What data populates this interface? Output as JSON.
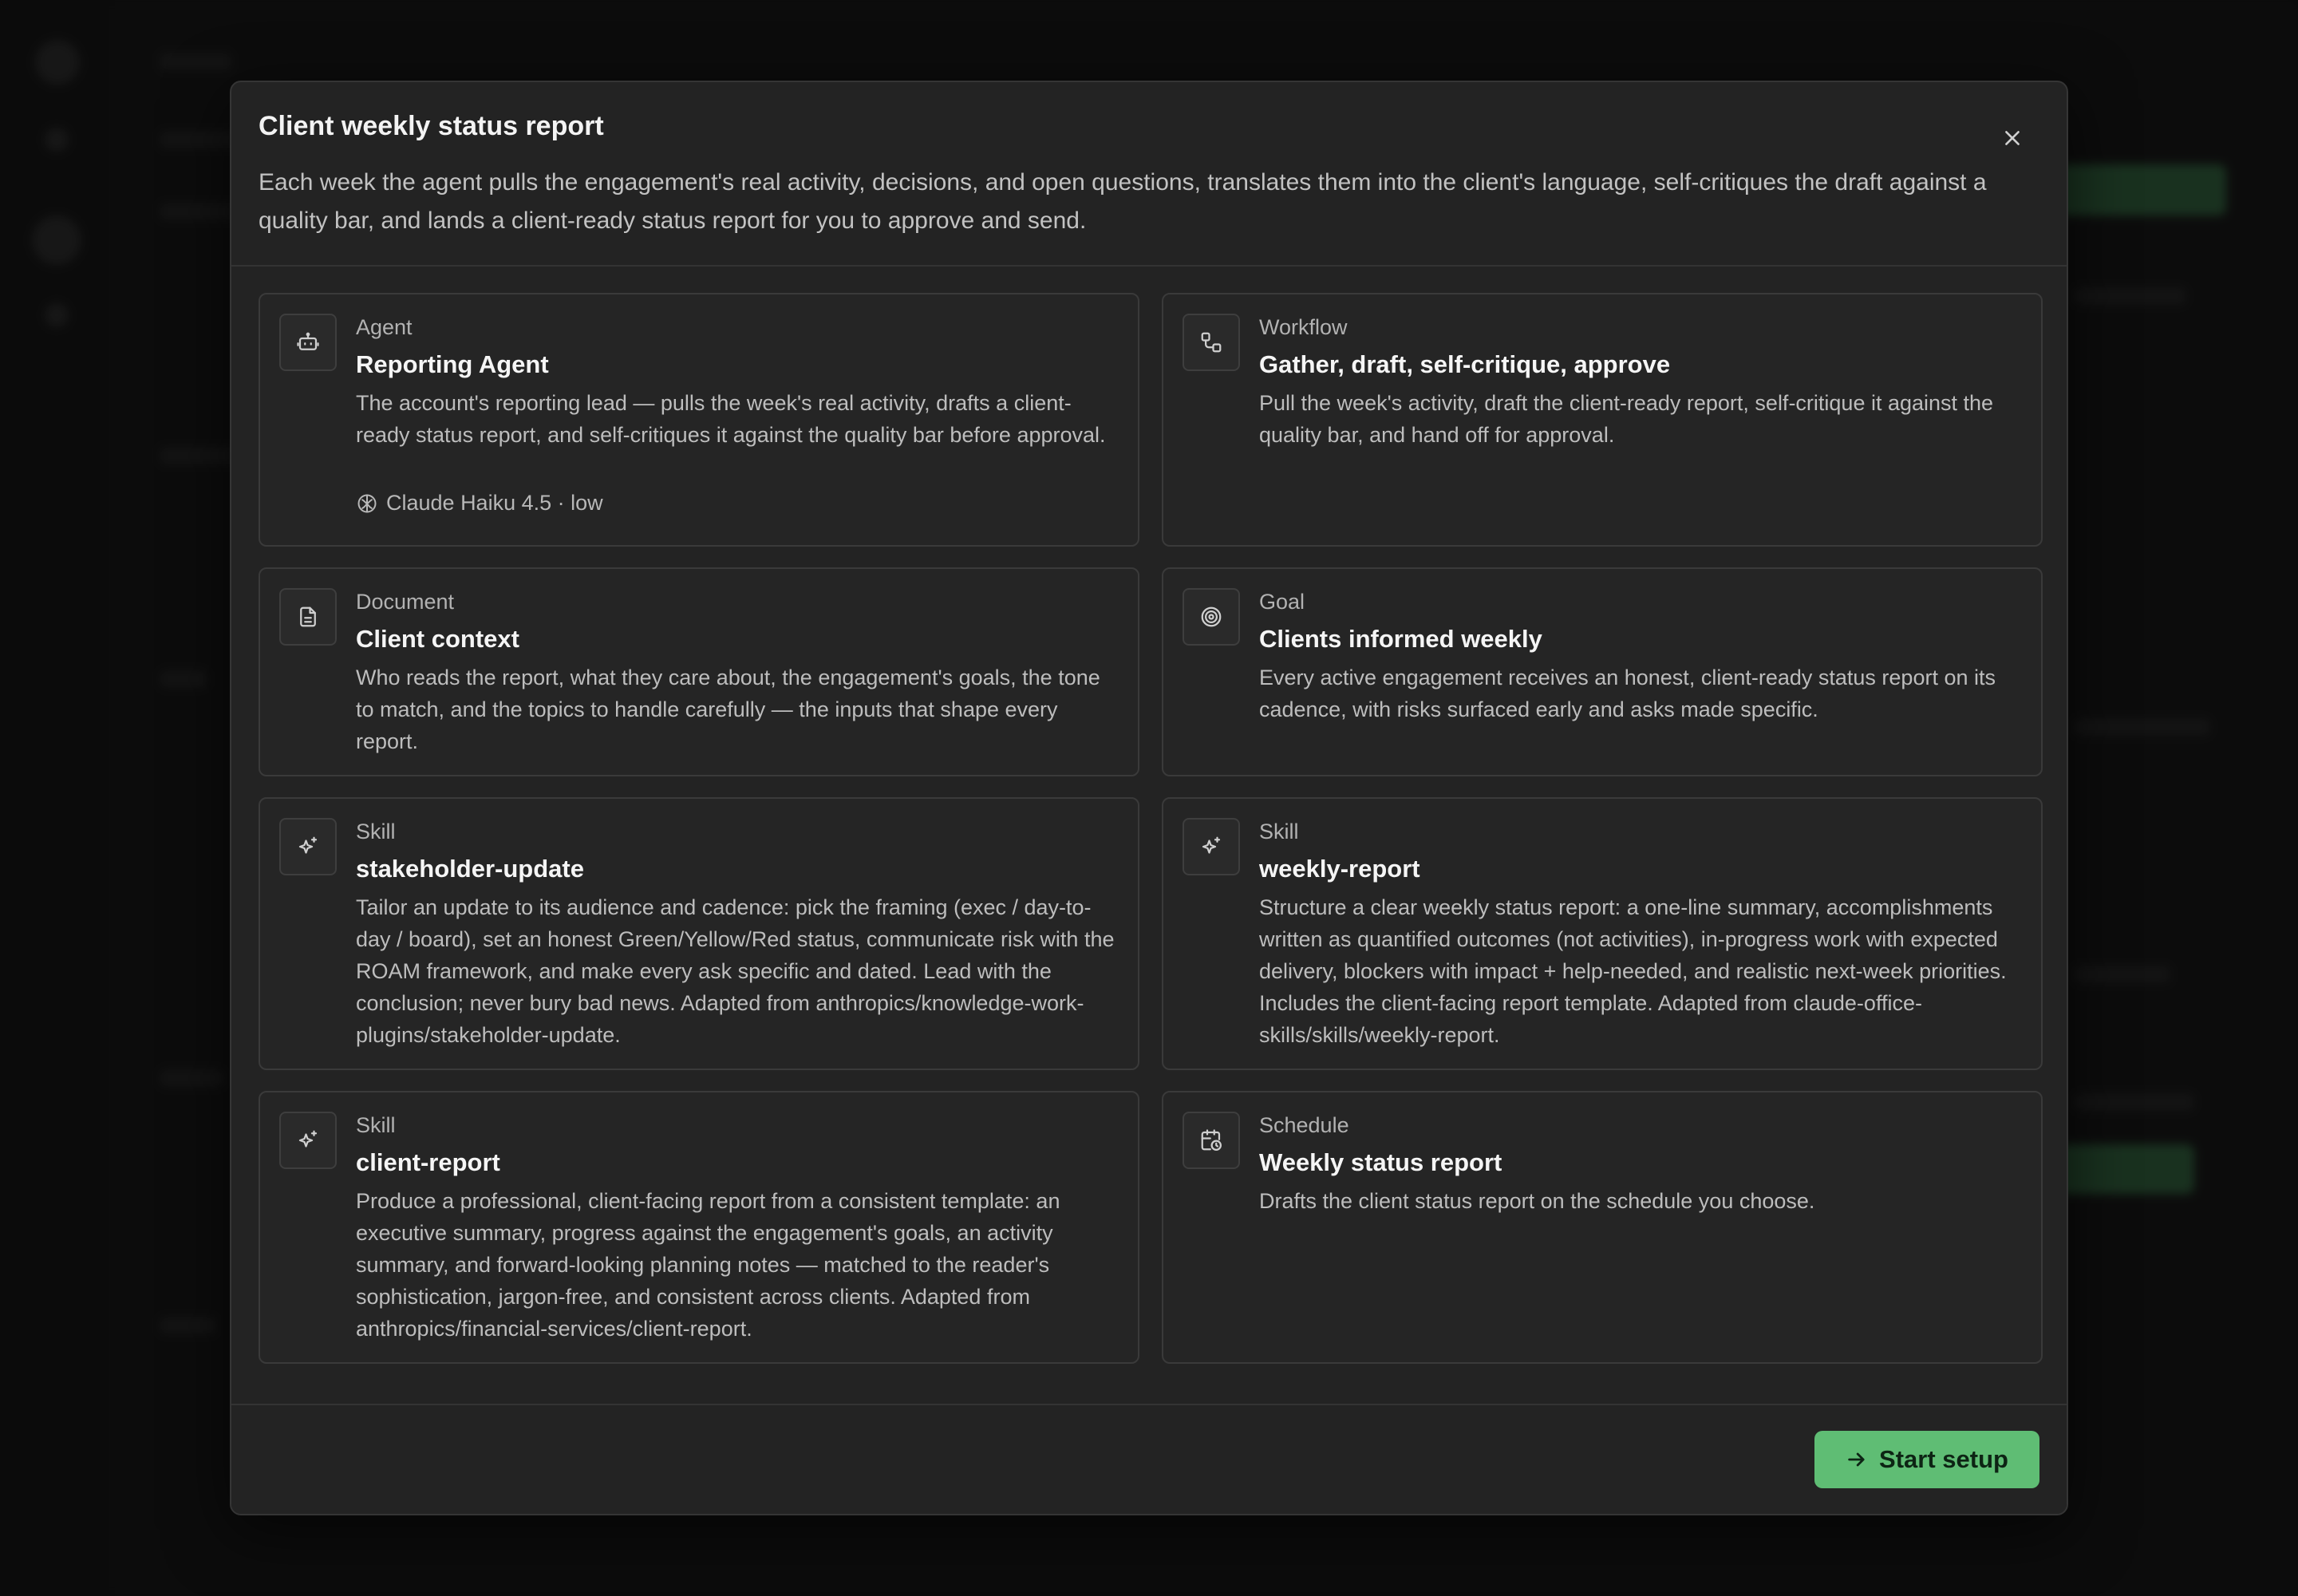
{
  "modal": {
    "title": "Client weekly status report",
    "description": "Each week the agent pulls the engagement's real activity, decisions, and open questions, translates them into the client's language, self-critiques the draft against a quality bar, and lands a client-ready status report for you to approve and send."
  },
  "cards": [
    {
      "kind": "Agent",
      "name": "Reporting Agent",
      "body": "The account's reporting lead — pulls the week's real activity, drafts a client-ready status report, and self-critiques it against the quality bar before approval.",
      "meta": "Claude Haiku 4.5 · low",
      "icon": "robot-icon"
    },
    {
      "kind": "Workflow",
      "name": "Gather, draft, self-critique, approve",
      "body": "Pull the week's activity, draft the client-ready report, self-critique it against the quality bar, and hand off for approval.",
      "icon": "workflow-icon"
    },
    {
      "kind": "Document",
      "name": "Client context",
      "body": "Who reads the report, what they care about, the engagement's goals, the tone to match, and the topics to handle carefully — the inputs that shape every report.",
      "icon": "document-icon"
    },
    {
      "kind": "Goal",
      "name": "Clients informed weekly",
      "body": "Every active engagement receives an honest, client-ready status report on its cadence, with risks surfaced early and asks made specific.",
      "icon": "target-icon"
    },
    {
      "kind": "Skill",
      "name": "stakeholder-update",
      "body": "Tailor an update to its audience and cadence: pick the framing (exec / day-to-day / board), set an honest Green/Yellow/Red status, communicate risk with the ROAM framework, and make every ask specific and dated. Lead with the conclusion; never bury bad news. Adapted from anthropics/knowledge-work-plugins/stakeholder-update.",
      "icon": "sparkle-icon"
    },
    {
      "kind": "Skill",
      "name": "weekly-report",
      "body": "Structure a clear weekly status report: a one-line summary, accomplishments written as quantified outcomes (not activities), in-progress work with expected delivery, blockers with impact + help-needed, and realistic next-week priorities. Includes the client-facing report template. Adapted from claude-office-skills/skills/weekly-report.",
      "icon": "sparkle-icon"
    },
    {
      "kind": "Skill",
      "name": "client-report",
      "body": "Produce a professional, client-facing report from a consistent template: an executive summary, progress against the engagement's goals, an activity summary, and forward-looking planning notes — matched to the reader's sophistication, jargon-free, and consistent across clients. Adapted from anthropics/financial-services/client-report.",
      "icon": "sparkle-icon"
    },
    {
      "kind": "Schedule",
      "name": "Weekly status report",
      "body": "Drafts the client status report on the schedule you choose.",
      "icon": "calendar-clock-icon"
    }
  ],
  "footer": {
    "start_label": "Start setup"
  },
  "colors": {
    "accent": "#5fbd74",
    "modal_bg": "#232323",
    "card_border": "#3a3a3a"
  }
}
